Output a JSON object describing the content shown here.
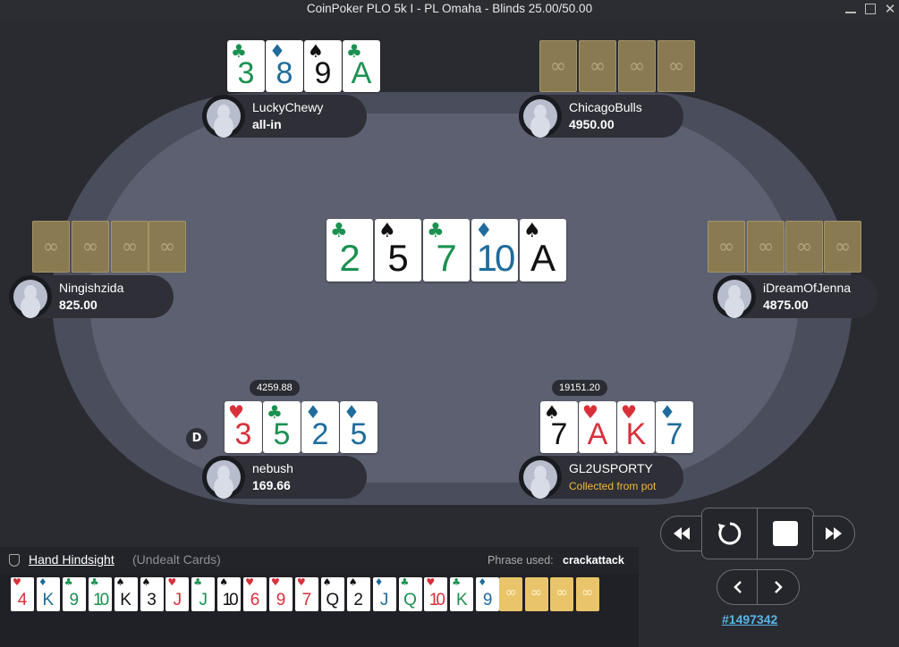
{
  "window": {
    "title": "CoinPoker PLO 5k I - PL Omaha - Blinds 25.00/50.00"
  },
  "players": [
    {
      "name": "LuckyChewy",
      "stack": "all-in",
      "cards": [
        {
          "rank": "3",
          "suit": "♣",
          "color": "c"
        },
        {
          "rank": "8",
          "suit": "♦",
          "color": "d"
        },
        {
          "rank": "9",
          "suit": "♠",
          "color": "s"
        },
        {
          "rank": "A",
          "suit": "♣",
          "color": "c"
        }
      ]
    },
    {
      "name": "ChicagoBulls",
      "stack": "4950.00"
    },
    {
      "name": "Ningishzida",
      "stack": "825.00"
    },
    {
      "name": "iDreamOfJenna",
      "stack": "4875.00"
    },
    {
      "name": "nebush",
      "stack": "169.66",
      "bet": "4259.88",
      "dealer": "D",
      "cards": [
        {
          "rank": "3",
          "suit": "♥",
          "color": "h"
        },
        {
          "rank": "5",
          "suit": "♣",
          "color": "c"
        },
        {
          "rank": "2",
          "suit": "♦",
          "color": "d"
        },
        {
          "rank": "5",
          "suit": "♦",
          "color": "d"
        }
      ]
    },
    {
      "name": "GL2USPORTY",
      "stack": "Collected from pot",
      "bet": "19151.20",
      "cards": [
        {
          "rank": "7",
          "suit": "♠",
          "color": "s"
        },
        {
          "rank": "A",
          "suit": "♥",
          "color": "h"
        },
        {
          "rank": "K",
          "suit": "♥",
          "color": "h"
        },
        {
          "rank": "7",
          "suit": "♦",
          "color": "d"
        }
      ]
    }
  ],
  "board": [
    {
      "rank": "2",
      "suit": "♣",
      "color": "c"
    },
    {
      "rank": "5",
      "suit": "♠",
      "color": "s"
    },
    {
      "rank": "7",
      "suit": "♣",
      "color": "c"
    },
    {
      "rank": "10",
      "suit": "♦",
      "color": "d"
    },
    {
      "rank": "A",
      "suit": "♠",
      "color": "s"
    }
  ],
  "hindsight": {
    "title": "Hand Hindsight",
    "subtitle": "(Undealt Cards)",
    "phrase_label": "Phrase used:",
    "phrase": "crackattack",
    "cards": [
      {
        "rank": "4",
        "suit": "♥",
        "color": "h"
      },
      {
        "rank": "K",
        "suit": "♦",
        "color": "d"
      },
      {
        "rank": "9",
        "suit": "♣",
        "color": "c"
      },
      {
        "rank": "10",
        "suit": "♣",
        "color": "c"
      },
      {
        "rank": "K",
        "suit": "♠",
        "color": "s"
      },
      {
        "rank": "3",
        "suit": "♠",
        "color": "s"
      },
      {
        "rank": "J",
        "suit": "♥",
        "color": "h"
      },
      {
        "rank": "J",
        "suit": "♣",
        "color": "c"
      },
      {
        "rank": "10",
        "suit": "♠",
        "color": "s"
      },
      {
        "rank": "6",
        "suit": "♥",
        "color": "h"
      },
      {
        "rank": "9",
        "suit": "♥",
        "color": "h"
      },
      {
        "rank": "7",
        "suit": "♥",
        "color": "h"
      },
      {
        "rank": "Q",
        "suit": "♠",
        "color": "s"
      },
      {
        "rank": "2",
        "suit": "♠",
        "color": "s"
      },
      {
        "rank": "J",
        "suit": "♦",
        "color": "d"
      },
      {
        "rank": "Q",
        "suit": "♣",
        "color": "c"
      },
      {
        "rank": "10",
        "suit": "♥",
        "color": "h"
      },
      {
        "rank": "K",
        "suit": "♣",
        "color": "c"
      },
      {
        "rank": "9",
        "suit": "♦",
        "color": "d"
      }
    ]
  },
  "replay": {
    "hand_id": "#1497342"
  }
}
